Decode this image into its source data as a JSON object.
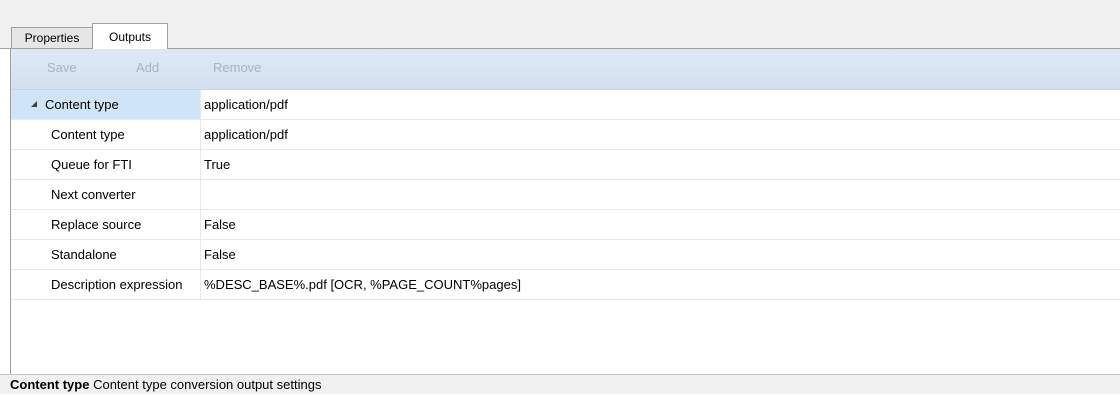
{
  "tabs": [
    {
      "label": "Properties"
    },
    {
      "label": "Outputs"
    }
  ],
  "toolbar": {
    "save_label": "Save",
    "add_label": "Add",
    "remove_label": "Remove"
  },
  "grid": {
    "group": {
      "name": "Content type",
      "value": "application/pdf"
    },
    "rows": [
      {
        "name": "Content type",
        "value": "application/pdf"
      },
      {
        "name": "Queue for FTI",
        "value": "True"
      },
      {
        "name": "Next converter",
        "value": ""
      },
      {
        "name": "Replace source",
        "value": "False"
      },
      {
        "name": "Standalone",
        "value": "False"
      },
      {
        "name": "Description expression",
        "value": "%DESC_BASE%.pdf [OCR, %PAGE_COUNT%pages]"
      }
    ]
  },
  "status": {
    "title": "Content type",
    "description": "Content type conversion output settings"
  }
}
